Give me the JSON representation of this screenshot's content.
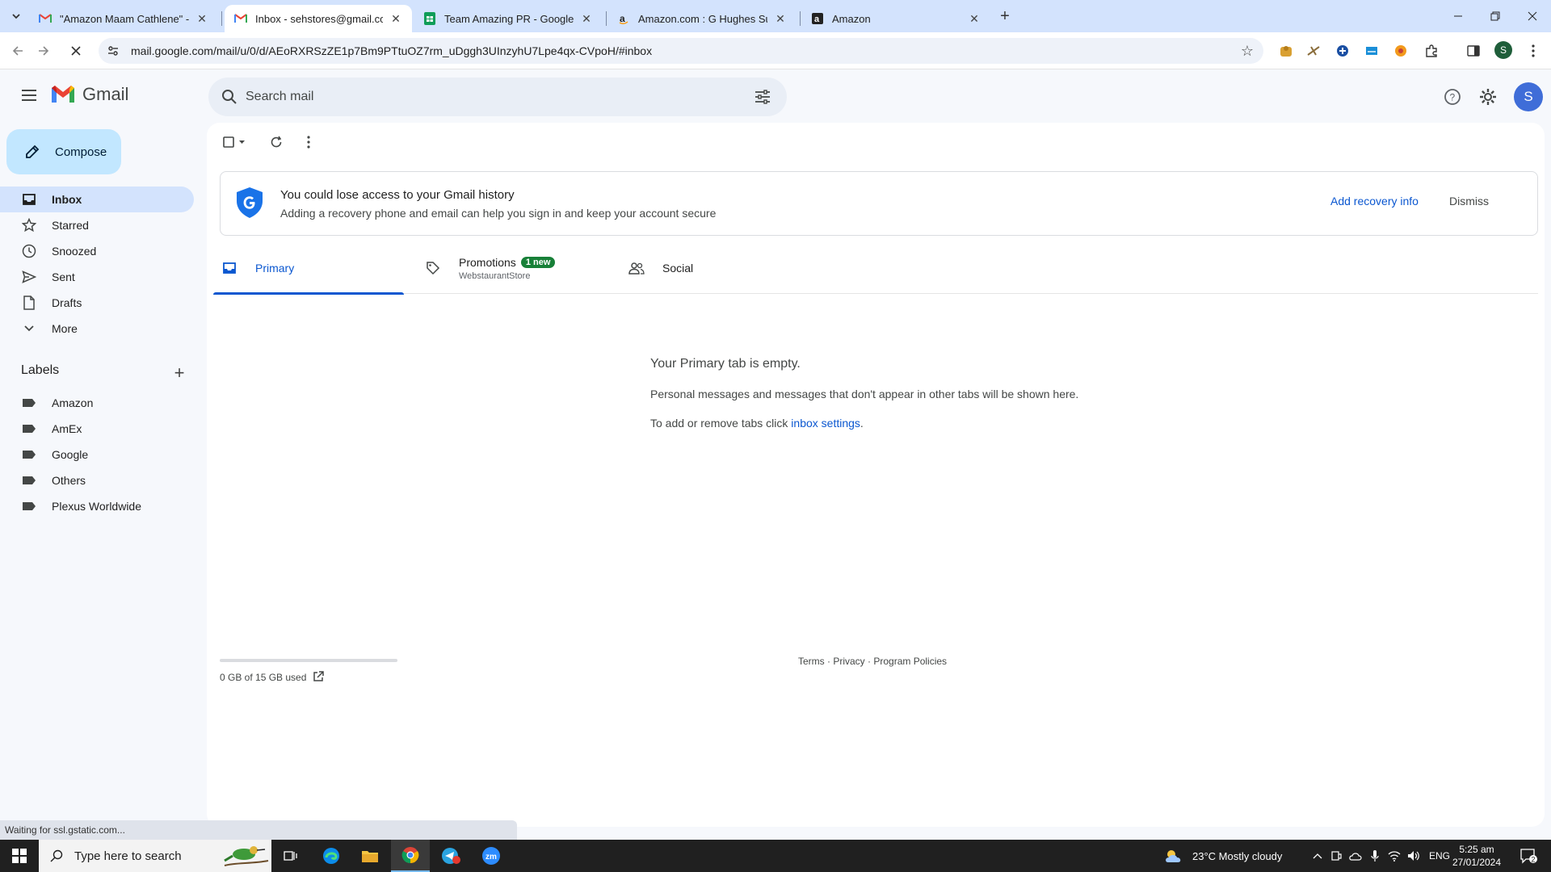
{
  "browser": {
    "tabs": [
      {
        "title": "\"Amazon Maam Cathlene\" - c",
        "icon": "gmail-icon",
        "active": false
      },
      {
        "title": "Inbox - sehstores@gmail.com -",
        "icon": "gmail-icon",
        "active": true
      },
      {
        "title": "Team Amazing PR - Google She",
        "icon": "sheets-icon",
        "active": false
      },
      {
        "title": "Amazon.com : G Hughes Sugar",
        "icon": "amazon-icon",
        "active": false
      },
      {
        "title": "Amazon",
        "icon": "amazon-icon",
        "active": false
      }
    ],
    "url": "mail.google.com/mail/u/0/d/AEoRXRSzZE1p7Bm9PTtuOZ7rm_uDggh3UInzyhU7Lpe4qx-CVpoH/#inbox",
    "profile_initial": "S",
    "status_text": "Waiting for ssl.gstatic.com..."
  },
  "gmail": {
    "brand": "Gmail",
    "search_placeholder": "Search mail",
    "avatar_initial": "S",
    "compose_label": "Compose",
    "nav": [
      {
        "label": "Inbox",
        "icon": "inbox-icon",
        "active": true
      },
      {
        "label": "Starred",
        "icon": "star-icon",
        "active": false
      },
      {
        "label": "Snoozed",
        "icon": "clock-icon",
        "active": false
      },
      {
        "label": "Sent",
        "icon": "send-icon",
        "active": false
      },
      {
        "label": "Drafts",
        "icon": "draft-icon",
        "active": false
      },
      {
        "label": "More",
        "icon": "chevron-down-icon",
        "active": false
      }
    ],
    "labels_title": "Labels",
    "labels": [
      "Amazon",
      "AmEx",
      "Google",
      "Others",
      "Plexus Worldwide"
    ],
    "banner": {
      "title": "You could lose access to your Gmail history",
      "text": "Adding a recovery phone and email can help you sign in and keep your account secure",
      "action": "Add recovery info",
      "dismiss": "Dismiss"
    },
    "tabs": {
      "primary": "Primary",
      "promotions": "Promotions",
      "promotions_badge": "1 new",
      "promotions_sub": "WebstaurantStore",
      "social": "Social"
    },
    "empty": {
      "title": "Your Primary tab is empty.",
      "line1": "Personal messages and messages that don't appear in other tabs will be shown here.",
      "line2_prefix": "To add or remove tabs click ",
      "line2_link": "inbox settings",
      "line2_suffix": "."
    },
    "storage": {
      "text": "0 GB of 15 GB used",
      "used_fraction": 0
    },
    "footer": {
      "terms": "Terms",
      "privacy": "Privacy",
      "policies": "Program Policies",
      "sep": " · "
    }
  },
  "taskbar": {
    "search_placeholder": "Type here to search",
    "weather": "23°C  Mostly cloudy",
    "language": "ENG",
    "time": "5:25 am",
    "date": "27/01/2024",
    "notification_count": "2"
  },
  "colors": {
    "accent": "#0b57d0",
    "compose": "#c2e7ff",
    "active_nav": "#d3e3fd",
    "badge": "#188038",
    "gmail_red": "#ea4335"
  }
}
